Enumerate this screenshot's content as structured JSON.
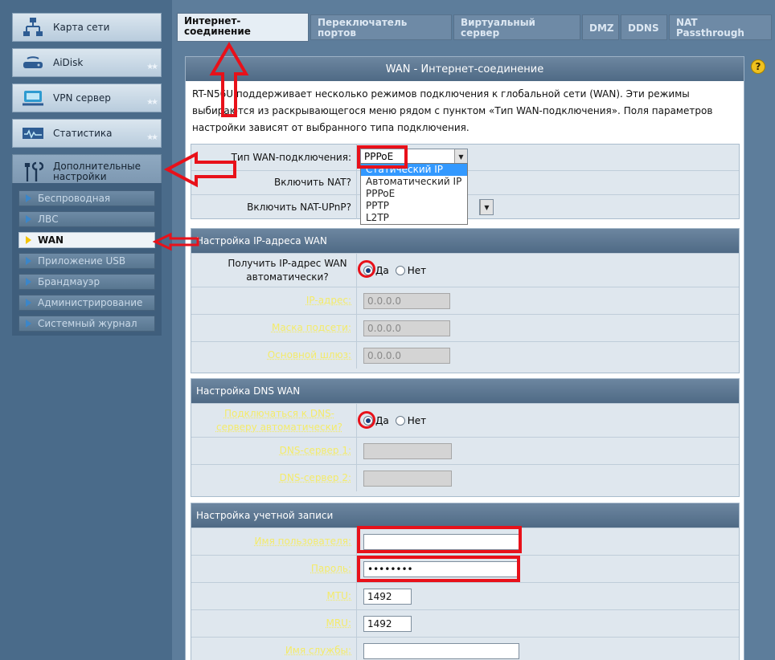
{
  "sidebar": {
    "main_items": [
      {
        "label": "Карта сети",
        "icon": "network-map-icon"
      },
      {
        "label": "AiDisk",
        "icon": "aidisk-icon"
      },
      {
        "label": "VPN сервер",
        "icon": "vpn-icon"
      },
      {
        "label": "Статистика",
        "icon": "statistics-icon"
      },
      {
        "label": "Дополнительные настройки",
        "icon": "tools-icon"
      }
    ],
    "stars": "★★",
    "sub_items": [
      {
        "label": "Беспроводная"
      },
      {
        "label": "ЛВС"
      },
      {
        "label": "WAN"
      },
      {
        "label": "Приложение USB"
      },
      {
        "label": "Брандмауэр"
      },
      {
        "label": "Администрирование"
      },
      {
        "label": "Системный журнал"
      }
    ]
  },
  "tabs": [
    {
      "label": "Интернет-соединение"
    },
    {
      "label": "Переключатель портов"
    },
    {
      "label": "Виртуальный сервер"
    },
    {
      "label": "DMZ"
    },
    {
      "label": "DDNS"
    },
    {
      "label": "NAT Passthrough"
    }
  ],
  "panel": {
    "title": "WAN - Интернет-соединение",
    "intro": "RT-N56U поддерживает несколько режимов подключения к глобальной сети (WAN). Эти режимы выбираются из раскрывающегося меню рядом с пунктом «Тип WAN-подключения». Поля параметров настройки зависят от выбранного типа подключения.",
    "help": "?"
  },
  "wan_basic": {
    "type_label": "Тип WAN-подключения:",
    "type_value": "PPPoE",
    "nat_label": "Включить NAT?",
    "upnp_label": "Включить NAT-UPnP?",
    "dropdown_options": [
      "Статический IP",
      "Автоматический IP",
      "PPPoE",
      "PPTP",
      "L2TP"
    ],
    "dropdown_selected_index": 0
  },
  "ip_section": {
    "title": "Настройка IP-адреса WAN",
    "auto_label": "Получить IP-адрес WAN автоматически?",
    "yes": "Да",
    "no": "Нет",
    "ip_label": "IP-адрес:",
    "ip_value": "0.0.0.0",
    "mask_label": "Маска подсети:",
    "mask_value": "0.0.0.0",
    "gateway_label": "Основной шлюз:",
    "gateway_value": "0.0.0.0"
  },
  "dns_section": {
    "title": "Настройка DNS WAN",
    "auto_label": "Подключаться к DNS-серверу автоматически?",
    "yes": "Да",
    "no": "Нет",
    "dns1_label": "DNS-сервер 1:",
    "dns1_value": "",
    "dns2_label": "DNS-сервер 2:",
    "dns2_value": ""
  },
  "account_section": {
    "title": "Настройка учетной записи",
    "user_label": "Имя пользователя:",
    "user_value": "",
    "pass_label": "Пароль:",
    "pass_value": "••••••••",
    "mtu_label": "MTU:",
    "mtu_value": "1492",
    "mru_label": "MRU:",
    "mru_value": "1492",
    "service_label": "Имя службы:",
    "service_value": ""
  },
  "colors": {
    "annotation_red": "#e8111a",
    "header_blue": "#4f6a85",
    "link_yellow": "#f4eb6a"
  }
}
